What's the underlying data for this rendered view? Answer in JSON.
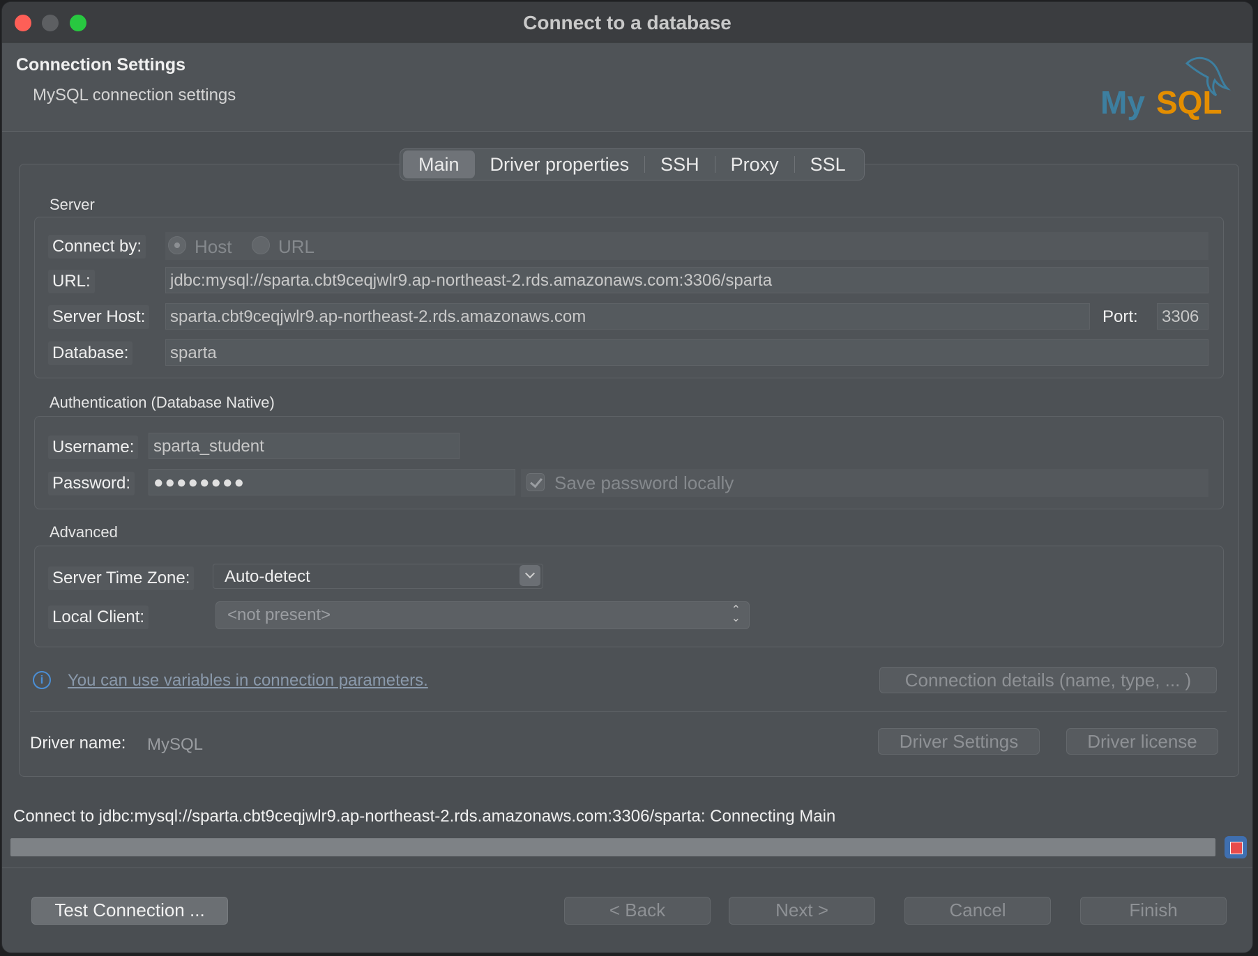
{
  "window": {
    "title": "Connect to a database"
  },
  "header": {
    "title": "Connection Settings",
    "subtitle": "MySQL connection settings",
    "logo_text": "MySQL"
  },
  "tabs": [
    {
      "label": "Main",
      "active": true
    },
    {
      "label": "Driver properties",
      "active": false
    },
    {
      "label": "SSH",
      "active": false
    },
    {
      "label": "Proxy",
      "active": false
    },
    {
      "label": "SSL",
      "active": false
    }
  ],
  "server": {
    "section_label": "Server",
    "connect_by_label": "Connect by:",
    "connect_by_options": [
      "Host",
      "URL"
    ],
    "connect_by_selected": "Host",
    "url_label": "URL:",
    "url_value": "jdbc:mysql://sparta.cbt9ceqjwlr9.ap-northeast-2.rds.amazonaws.com:3306/sparta",
    "host_label": "Server Host:",
    "host_value": "sparta.cbt9ceqjwlr9.ap-northeast-2.rds.amazonaws.com",
    "port_label": "Port:",
    "port_value": "3306",
    "database_label": "Database:",
    "database_value": "sparta"
  },
  "auth": {
    "section_label": "Authentication (Database Native)",
    "username_label": "Username:",
    "username_value": "sparta_student",
    "password_label": "Password:",
    "password_value": "●●●●●●●●",
    "save_password_label": "Save password locally",
    "save_password_checked": true
  },
  "advanced": {
    "section_label": "Advanced",
    "timezone_label": "Server Time Zone:",
    "timezone_value": "Auto-detect",
    "local_client_label": "Local Client:",
    "local_client_value": "<not present>"
  },
  "info": {
    "link_text": "You can use variables in connection parameters.",
    "connection_details_button": "Connection details (name, type, ... )"
  },
  "driver": {
    "name_label": "Driver name:",
    "name_value": "MySQL",
    "settings_button": "Driver Settings",
    "license_button": "Driver license"
  },
  "status": {
    "text": "Connect to jdbc:mysql://sparta.cbt9ceqjwlr9.ap-northeast-2.rds.amazonaws.com:3306/sparta: Connecting Main",
    "progress_percent": 100
  },
  "footer": {
    "test_button": "Test Connection ...",
    "back_button": "< Back",
    "next_button": "Next >",
    "cancel_button": "Cancel",
    "finish_button": "Finish"
  },
  "colors": {
    "close": "#fe5f57",
    "maximize": "#28c840",
    "logo_blue": "#3d7fa0",
    "logo_orange": "#e48e00",
    "info_blue": "#4b8fd6",
    "stop_red": "#e84b4b"
  }
}
